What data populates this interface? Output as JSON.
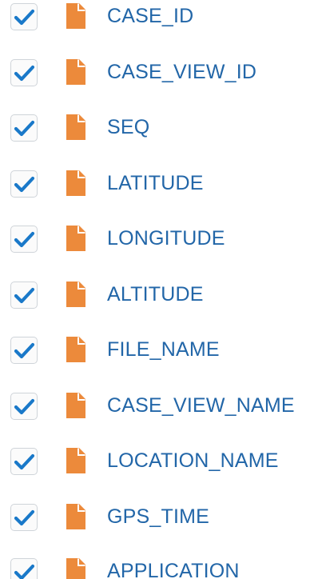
{
  "fields": [
    {
      "label": "CASE_ID",
      "checked": true
    },
    {
      "label": "CASE_VIEW_ID",
      "checked": true
    },
    {
      "label": "SEQ",
      "checked": true
    },
    {
      "label": "LATITUDE",
      "checked": true
    },
    {
      "label": "LONGITUDE",
      "checked": true
    },
    {
      "label": "ALTITUDE",
      "checked": true
    },
    {
      "label": "FILE_NAME",
      "checked": true
    },
    {
      "label": "CASE_VIEW_NAME",
      "checked": true
    },
    {
      "label": "LOCATION_NAME",
      "checked": true
    },
    {
      "label": "GPS_TIME",
      "checked": true
    },
    {
      "label": "APPLICATION",
      "checked": true
    }
  ],
  "icons": {
    "checkbox": "checkmark-icon",
    "field": "file-icon"
  },
  "colors": {
    "label": "#2266a8",
    "check": "#1a79c9",
    "file_icon": "#ec8a3b",
    "checkbox_border": "#cfd4d9"
  }
}
